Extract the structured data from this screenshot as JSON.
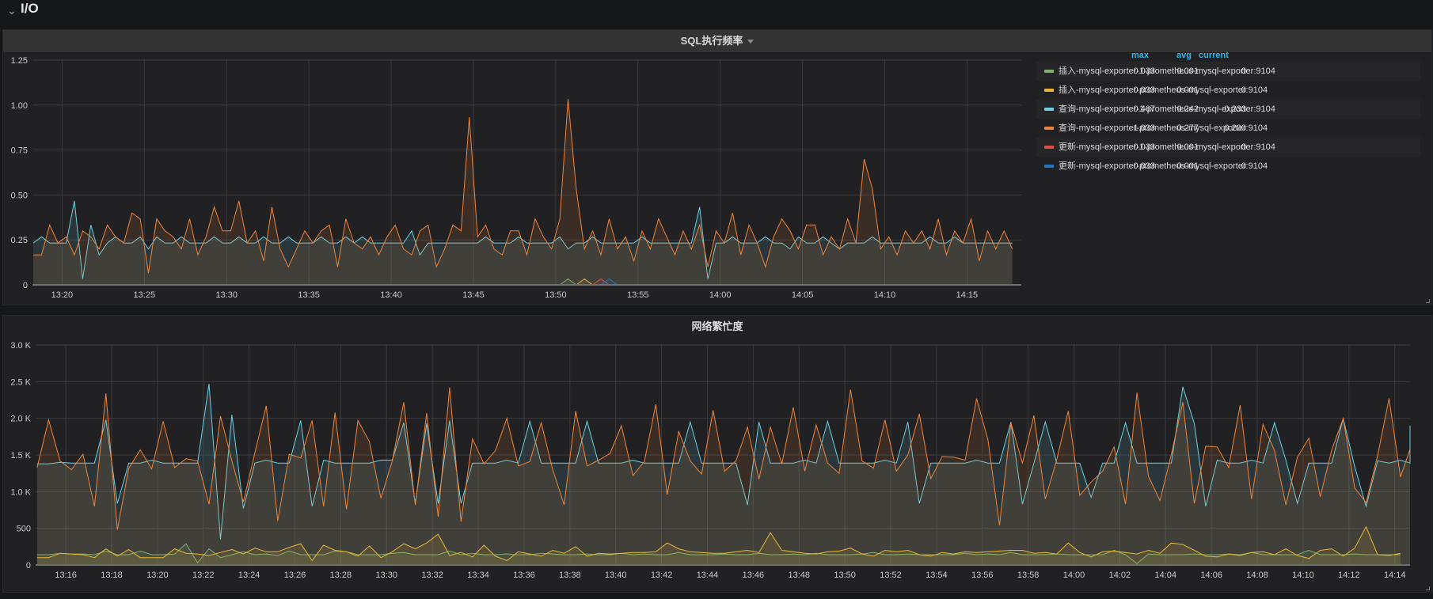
{
  "row": {
    "title": "I/O"
  },
  "panels": [
    {
      "title": "SQL执行频率",
      "legend": {
        "columns": [
          "max",
          "avg",
          "current"
        ],
        "items": [
          {
            "name": "插入-mysql-exporter-1-prometheus-mysql-exporter:9104",
            "color": "#7eb26d",
            "max": "0.033",
            "avg": "0.001",
            "current": "0"
          },
          {
            "name": "插入-mysql-exporter-prometheus-mysql-exporter:9104",
            "color": "#eab839",
            "max": "0.033",
            "avg": "0.001",
            "current": "0"
          },
          {
            "name": "查询-mysql-exporter-1-prometheus-mysql-exporter:9104",
            "color": "#6ed0e0",
            "max": "0.467",
            "avg": "0.242",
            "current": "0.233"
          },
          {
            "name": "查询-mysql-exporter-prometheus-mysql-exporter:9104",
            "color": "#ef843c",
            "max": "1.033",
            "avg": "0.277",
            "current": "0.200"
          },
          {
            "name": "更新-mysql-exporter-1-prometheus-mysql-exporter:9104",
            "color": "#e24d42",
            "max": "0.033",
            "avg": "0.001",
            "current": "0"
          },
          {
            "name": "更新-mysql-exporter-prometheus-mysql-exporter:9104",
            "color": "#1f78c1",
            "max": "0.033",
            "avg": "0.001",
            "current": "0"
          }
        ]
      }
    },
    {
      "title": "网络繁忙度"
    }
  ],
  "chart_data": [
    {
      "type": "line",
      "title": "SQL执行频率",
      "ylim": [
        0,
        1.25
      ],
      "yticks": [
        "0",
        "0.25",
        "0.50",
        "0.75",
        "1.00",
        "1.25"
      ],
      "ytick_values": [
        0,
        0.25,
        0.5,
        0.75,
        1.0,
        1.25
      ],
      "xrange_minutes": [
        "13:18:12",
        "14:18:18"
      ],
      "xticks": [
        "13:20",
        "13:25",
        "13:30",
        "13:35",
        "13:40",
        "13:45",
        "13:50",
        "13:55",
        "14:00",
        "14:05",
        "14:10",
        "14:15"
      ],
      "start": "13:18:15",
      "step_sec": 30,
      "grid": true,
      "legend_placement": "right",
      "series": [
        {
          "name": "插入-mysql-exporter-1-prometheus-mysql-exporter:9104",
          "color": "#7eb26d",
          "spikes": [
            [
              65,
              0.033
            ]
          ]
        },
        {
          "name": "插入-mysql-exporter-prometheus-mysql-exporter:9104",
          "color": "#eab839",
          "spikes": [
            [
              67,
              0.033
            ]
          ]
        },
        {
          "name": "查询-mysql-exporter-1-prometheus-mysql-exporter:9104",
          "color": "#6ed0e0",
          "values": [
            0.233,
            0.267,
            0.233,
            0.233,
            0.233,
            0.467,
            0.033,
            0.333,
            0.167,
            0.233,
            0.267,
            0.233,
            0.233,
            0.267,
            0.2,
            0.267,
            0.233,
            0.233,
            0.267,
            0.233,
            0.233,
            0.233,
            0.267,
            0.233,
            0.233,
            0.267,
            0.233,
            0.233,
            0.267,
            0.233,
            0.233,
            0.267,
            0.233,
            0.233,
            0.233,
            0.267,
            0.233,
            0.233,
            0.267,
            0.233,
            0.267,
            0.233,
            0.233,
            0.233,
            0.233,
            0.233,
            0.3,
            0.167,
            0.233,
            0.233,
            0.233,
            0.233,
            0.233,
            0.233,
            0.233,
            0.267,
            0.233,
            0.233,
            0.233,
            0.267,
            0.233,
            0.233,
            0.233,
            0.233,
            0.267,
            0.2,
            0.233,
            0.233,
            0.267,
            0.233,
            0.233,
            0.233,
            0.233,
            0.233,
            0.267,
            0.233,
            0.233,
            0.233,
            0.233,
            0.233,
            0.233,
            0.433,
            0.033,
            0.233,
            0.233,
            0.267,
            0.233,
            0.233,
            0.233,
            0.267,
            0.233,
            0.233,
            0.2,
            0.267,
            0.233,
            0.233,
            0.267,
            0.233,
            0.2,
            0.233,
            0.233,
            0.233,
            0.267,
            0.233,
            0.233,
            0.233,
            0.233,
            0.233,
            0.233,
            0.267,
            0.233,
            0.233,
            0.267,
            0.233,
            0.233,
            0.233,
            0.233,
            0.233,
            0.233,
            0.233
          ]
        },
        {
          "name": "查询-mysql-exporter-prometheus-mysql-exporter:9104",
          "color": "#ef843c",
          "values": [
            0.167,
            0.167,
            0.333,
            0.233,
            0.267,
            0.167,
            0.3,
            0.267,
            0.2,
            0.333,
            0.267,
            0.233,
            0.4,
            0.367,
            0.067,
            0.367,
            0.3,
            0.267,
            0.2,
            0.367,
            0.167,
            0.267,
            0.433,
            0.3,
            0.3,
            0.467,
            0.233,
            0.3,
            0.133,
            0.433,
            0.2,
            0.1,
            0.2,
            0.3,
            0.233,
            0.3,
            0.333,
            0.1,
            0.367,
            0.233,
            0.2,
            0.267,
            0.167,
            0.267,
            0.333,
            0.2,
            0.167,
            0.3,
            0.333,
            0.1,
            0.2,
            0.333,
            0.3,
            0.933,
            0.267,
            0.333,
            0.2,
            0.167,
            0.3,
            0.3,
            0.167,
            0.367,
            0.267,
            0.2,
            0.367,
            1.033,
            0.533,
            0.2,
            0.3,
            0.167,
            0.367,
            0.2,
            0.267,
            0.133,
            0.3,
            0.2,
            0.367,
            0.267,
            0.167,
            0.3,
            0.2,
            0.333,
            0.1,
            0.3,
            0.233,
            0.4,
            0.167,
            0.333,
            0.233,
            0.1,
            0.267,
            0.367,
            0.3,
            0.2,
            0.333,
            0.333,
            0.167,
            0.267,
            0.2,
            0.367,
            0.233,
            0.7,
            0.533,
            0.2,
            0.267,
            0.167,
            0.3,
            0.233,
            0.3,
            0.2,
            0.367,
            0.167,
            0.3,
            0.233,
            0.367,
            0.133,
            0.3,
            0.2,
            0.3,
            0.2
          ]
        },
        {
          "name": "更新-mysql-exporter-1-prometheus-mysql-exporter:9104",
          "color": "#e24d42",
          "spikes": [
            [
              69,
              0.033
            ]
          ]
        },
        {
          "name": "更新-mysql-exporter-prometheus-mysql-exporter:9104",
          "color": "#1f78c1",
          "spikes": [
            [
              70,
              0.033
            ]
          ]
        }
      ]
    },
    {
      "type": "line",
      "title": "网络繁忙度",
      "ylim": [
        0,
        3000
      ],
      "yticks": [
        "0",
        "500",
        "1.0 K",
        "1.5 K",
        "2.0 K",
        "2.5 K",
        "3.0 K"
      ],
      "ytick_values": [
        0,
        500,
        1000,
        1500,
        2000,
        2500,
        3000
      ],
      "xrange_minutes": [
        "13:14:41",
        "14:14:40"
      ],
      "xticks": [
        "13:16",
        "13:18",
        "13:20",
        "13:22",
        "13:24",
        "13:26",
        "13:28",
        "13:30",
        "13:32",
        "13:34",
        "13:36",
        "13:38",
        "13:40",
        "13:42",
        "13:44",
        "13:46",
        "13:48",
        "13:50",
        "13:52",
        "13:54",
        "13:56",
        "13:58",
        "14:00",
        "14:02",
        "14:04",
        "14:06",
        "14:08",
        "14:10",
        "14:12",
        "14:14"
      ],
      "start": "13:14:45",
      "step_sec": 30,
      "grid": true,
      "series": [
        {
          "name": "cyan",
          "color": "#6ed0e0",
          "values": [
            1380,
            1380,
            1400,
            1390,
            1390,
            1390,
            1980,
            840,
            1390,
            1390,
            1430,
            1390,
            1390,
            1390,
            1390,
            2470,
            350,
            2050,
            770,
            1390,
            1430,
            1390,
            1390,
            1970,
            800,
            1430,
            1390,
            1390,
            1390,
            1390,
            1430,
            1430,
            1940,
            840,
            1930,
            840,
            1970,
            840,
            1390,
            1390,
            1390,
            1430,
            1390,
            1960,
            1390,
            1390,
            1390,
            1390,
            1960,
            1390,
            1390,
            1390,
            1430,
            1390,
            1390,
            1390,
            1390,
            1950,
            1390,
            1390,
            1390,
            1390,
            820,
            1950,
            1390,
            1390,
            1390,
            1430,
            1390,
            1960,
            1390,
            1390,
            1390,
            1390,
            1430,
            1390,
            1950,
            840,
            1390,
            1390,
            1390,
            1390,
            1430,
            1390,
            1390,
            1950,
            830,
            1390,
            1950,
            1390,
            1390,
            1390,
            920,
            1390,
            1390,
            1940,
            1390,
            1390,
            1390,
            1390,
            2430,
            1930,
            800,
            1430,
            1390,
            1390,
            1430,
            1390,
            1940,
            1430,
            840,
            1390,
            1390,
            1390,
            2000,
            1340,
            800,
            1420,
            1390,
            1430,
            1390,
            1900,
            1430,
            1390
          ]
        },
        {
          "name": "orange",
          "color": "#ef843c",
          "values": [
            1330,
            1980,
            1420,
            1300,
            1510,
            800,
            2340,
            480,
            1320,
            1570,
            1310,
            1960,
            1330,
            1450,
            1420,
            830,
            2030,
            1420,
            860,
            1530,
            2170,
            600,
            1510,
            1460,
            1970,
            800,
            2080,
            760,
            1970,
            1680,
            910,
            1420,
            2220,
            820,
            2070,
            660,
            2420,
            590,
            1720,
            1380,
            1560,
            2000,
            1350,
            1410,
            1940,
            1300,
            820,
            2100,
            1350,
            1430,
            1520,
            1900,
            1220,
            1410,
            2190,
            960,
            1820,
            1420,
            1240,
            2110,
            1280,
            1420,
            1880,
            1170,
            1880,
            1380,
            2150,
            1280,
            1910,
            1390,
            1250,
            2390,
            1420,
            1320,
            1980,
            1280,
            1500,
            2060,
            1180,
            1480,
            1470,
            1430,
            2270,
            1700,
            540,
            1940,
            1390,
            2040,
            900,
            1440,
            2100,
            950,
            1130,
            1280,
            1610,
            830,
            2350,
            1210,
            880,
            1510,
            2220,
            840,
            1620,
            1610,
            1330,
            2180,
            900,
            1920,
            1560,
            820,
            1470,
            1730,
            930,
            1570,
            2000,
            1050,
            850,
            1490,
            2270,
            1200,
            1580
          ]
        },
        {
          "name": "green",
          "color": "#7eb26d",
          "values": [
            140,
            140,
            160,
            150,
            150,
            140,
            190,
            140,
            140,
            190,
            140,
            140,
            150,
            290,
            30,
            220,
            100,
            140,
            180,
            140,
            150,
            130,
            190,
            140,
            140,
            140,
            190,
            180,
            140,
            140,
            140,
            160,
            170,
            140,
            140,
            140,
            190,
            140,
            160,
            140,
            140,
            150,
            140,
            140,
            160,
            150,
            140,
            140,
            150,
            140,
            140,
            160,
            140,
            150,
            140,
            140,
            170,
            140,
            140,
            140,
            150,
            140,
            140,
            160,
            140,
            140,
            150,
            140,
            160,
            140,
            140,
            140,
            150,
            170,
            140,
            140,
            150,
            140,
            140,
            140,
            140,
            160,
            140,
            150,
            140,
            170,
            140,
            140,
            140,
            150,
            140,
            140,
            140,
            140,
            200,
            140,
            20,
            150,
            140,
            140,
            140,
            150,
            140,
            140,
            150,
            140,
            170,
            140,
            140,
            140,
            140,
            200,
            140,
            140,
            140,
            150,
            140,
            140,
            140,
            140
          ]
        },
        {
          "name": "yellow",
          "color": "#eab839",
          "values": [
            100,
            100,
            160,
            150,
            140,
            100,
            220,
            120,
            210,
            100,
            100,
            100,
            220,
            160,
            150,
            130,
            170,
            210,
            150,
            230,
            180,
            180,
            240,
            290,
            60,
            270,
            200,
            180,
            120,
            260,
            100,
            180,
            290,
            220,
            300,
            420,
            130,
            170,
            110,
            270,
            120,
            60,
            180,
            150,
            120,
            200,
            160,
            250,
            120,
            160,
            150,
            160,
            170,
            170,
            180,
            300,
            220,
            180,
            170,
            160,
            160,
            180,
            200,
            170,
            440,
            200,
            180,
            160,
            150,
            180,
            190,
            230,
            150,
            120,
            200,
            180,
            200,
            140,
            120,
            170,
            150,
            180,
            170,
            180,
            190,
            200,
            200,
            160,
            170,
            150,
            300,
            170,
            110,
            180,
            190,
            170,
            150,
            200,
            160,
            300,
            280,
            200,
            120,
            110,
            150,
            130,
            170,
            180,
            140,
            220,
            130,
            90,
            200,
            220,
            120,
            230,
            520,
            140,
            130,
            160
          ]
        }
      ]
    }
  ]
}
